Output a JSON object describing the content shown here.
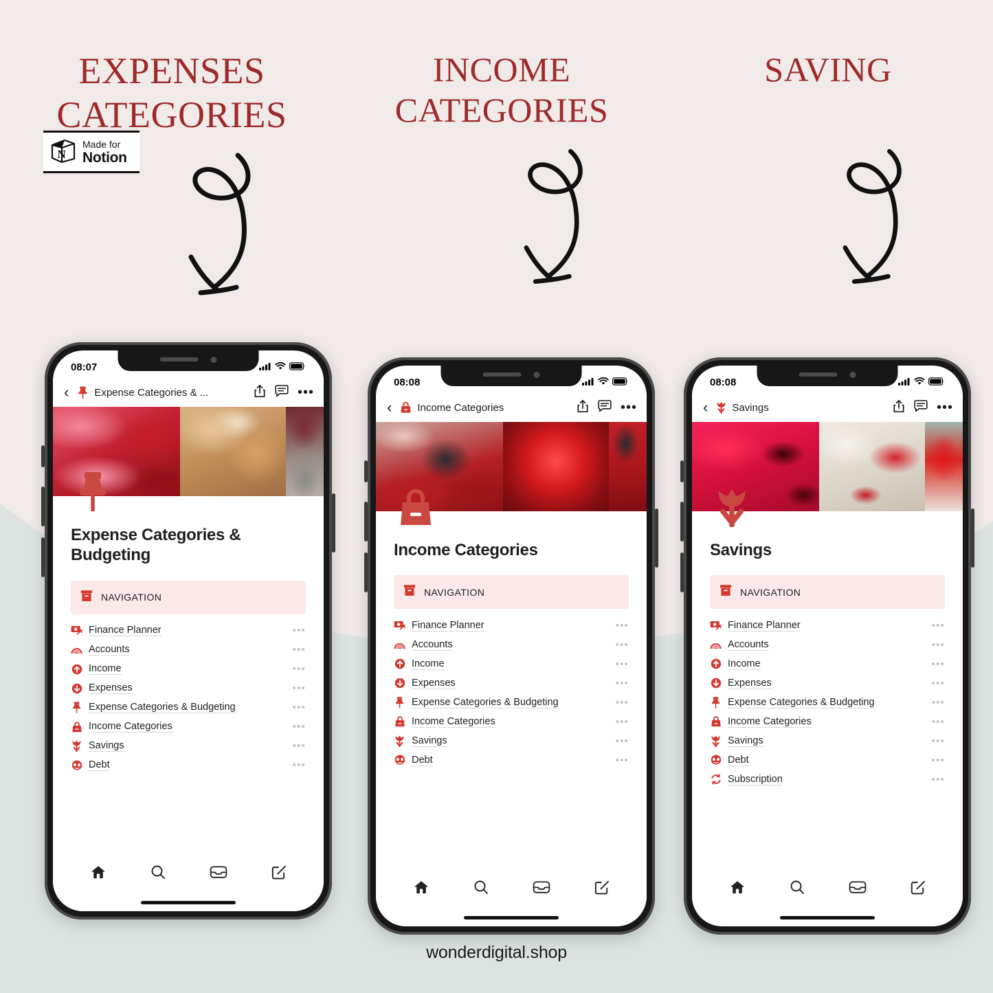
{
  "colors": {
    "bg_top": "#F0EAE9",
    "bg_bottom": "#DCE3E1",
    "headline_red": "#9E2A2B",
    "notion_red": "#E03E3E",
    "callout_bg": "#FBE9E9"
  },
  "headlines": [
    {
      "line1": "EXPENSES",
      "line2": "CATEGORIES"
    },
    {
      "line1": "INCOME",
      "line2": "CATEGORIES"
    },
    {
      "line1": "SAVING",
      "line2": ""
    }
  ],
  "notion_badge": {
    "made_for": "Made for",
    "brand": "Notion",
    "logo_letter": "N",
    "icon": "notion-cube-icon"
  },
  "arrows": [
    {
      "name": "curly-arrow-down-1"
    },
    {
      "name": "curly-arrow-down-2"
    },
    {
      "name": "curly-arrow-down-3"
    }
  ],
  "phones": [
    {
      "status": {
        "time": "08:07",
        "cellular": "signal-bars-icon",
        "wifi": "wifi-icon",
        "battery": "battery-full-icon"
      },
      "navbar": {
        "back": "‹",
        "icon": "pushpin-icon",
        "title": "Expense Categories & ...",
        "share": "share-icon",
        "comment": "comment-icon",
        "more": "•••"
      },
      "cover": {
        "alt": "collage of red dollar bills, chanel perfume, red shoe"
      },
      "page_icon": "pushpin-icon",
      "title": "Expense Categories & Budgeting",
      "callout": {
        "icon": "archive-box-icon",
        "label": "NAVIGATION"
      },
      "nav_items": [
        {
          "icon": "money-exchange-icon",
          "label": "Finance Planner",
          "dots": "•••"
        },
        {
          "icon": "rainbow-icon",
          "label": "Accounts",
          "dots": "•••"
        },
        {
          "icon": "arrow-up-circle-icon",
          "label": "Income",
          "dots": "•••"
        },
        {
          "icon": "arrow-down-circle-icon",
          "label": "Expenses",
          "dots": "•••"
        },
        {
          "icon": "pushpin-icon",
          "label": "Expense Categories & Budgeting",
          "dots": "•••"
        },
        {
          "icon": "handbag-icon",
          "label": "Income Categories",
          "dots": "•••"
        },
        {
          "icon": "tulip-icon",
          "label": "Savings",
          "dots": "•••"
        },
        {
          "icon": "alien-face-icon",
          "label": "Debt",
          "dots": "•••"
        }
      ],
      "tabbar": [
        "home-icon",
        "search-icon",
        "inbox-icon",
        "compose-icon"
      ]
    },
    {
      "status": {
        "time": "08:08",
        "cellular": "signal-bars-icon",
        "wifi": "wifi-icon",
        "battery": "battery-full-icon"
      },
      "navbar": {
        "back": "‹",
        "icon": "handbag-icon",
        "title": "Income Categories",
        "share": "share-icon",
        "comment": "comment-icon",
        "more": "•••"
      },
      "cover": {
        "alt": "collage of red shopping bags, red globe lamp, red coat"
      },
      "page_icon": "handbag-icon",
      "title": "Income Categories",
      "callout": {
        "icon": "archive-box-icon",
        "label": "NAVIGATION"
      },
      "nav_items": [
        {
          "icon": "money-exchange-icon",
          "label": "Finance Planner",
          "dots": "•••"
        },
        {
          "icon": "rainbow-icon",
          "label": "Accounts",
          "dots": "•••"
        },
        {
          "icon": "arrow-up-circle-icon",
          "label": "Income",
          "dots": "•••"
        },
        {
          "icon": "arrow-down-circle-icon",
          "label": "Expenses",
          "dots": "•••"
        },
        {
          "icon": "pushpin-icon",
          "label": "Expense Categories & Budgeting",
          "dots": "•••"
        },
        {
          "icon": "handbag-icon",
          "label": "Income Categories",
          "dots": "•••"
        },
        {
          "icon": "tulip-icon",
          "label": "Savings",
          "dots": "•••"
        },
        {
          "icon": "alien-face-icon",
          "label": "Debt",
          "dots": "•••"
        }
      ],
      "tabbar": [
        "home-icon",
        "search-icon",
        "inbox-icon",
        "compose-icon"
      ]
    },
    {
      "status": {
        "time": "08:08",
        "cellular": "signal-bars-icon",
        "wifi": "wifi-icon",
        "battery": "battery-full-icon"
      },
      "navbar": {
        "back": "‹",
        "icon": "tulip-icon",
        "title": "Savings",
        "share": "share-icon",
        "comment": "comment-icon",
        "more": "•••"
      },
      "cover": {
        "alt": "collage of red confetti, strawberries, red handbag"
      },
      "page_icon": "tulip-icon",
      "title": "Savings",
      "callout": {
        "icon": "archive-box-icon",
        "label": "NAVIGATION"
      },
      "nav_items": [
        {
          "icon": "money-exchange-icon",
          "label": "Finance Planner",
          "dots": "•••"
        },
        {
          "icon": "rainbow-icon",
          "label": "Accounts",
          "dots": "•••"
        },
        {
          "icon": "arrow-up-circle-icon",
          "label": "Income",
          "dots": "•••"
        },
        {
          "icon": "arrow-down-circle-icon",
          "label": "Expenses",
          "dots": "•••"
        },
        {
          "icon": "pushpin-icon",
          "label": "Expense Categories & Budgeting",
          "dots": "•••"
        },
        {
          "icon": "handbag-icon",
          "label": "Income Categories",
          "dots": "•••"
        },
        {
          "icon": "tulip-icon",
          "label": "Savings",
          "dots": "•••"
        },
        {
          "icon": "alien-face-icon",
          "label": "Debt",
          "dots": "•••"
        },
        {
          "icon": "subscription-refresh-icon",
          "label": "Subscription",
          "dots": "•••"
        }
      ],
      "tabbar": [
        "home-icon",
        "search-icon",
        "inbox-icon",
        "compose-icon"
      ]
    }
  ],
  "footer": {
    "text": "wonderdigital.shop"
  }
}
